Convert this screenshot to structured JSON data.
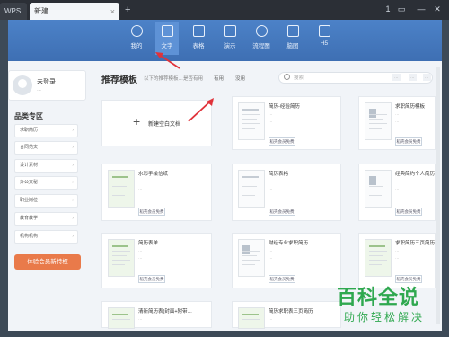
{
  "titlebar": {
    "app_label": "WPS",
    "tab_label": "新建",
    "tab_close": "×",
    "add_tab": "+",
    "controls": [
      "1",
      "▭",
      "—",
      "✕"
    ]
  },
  "categories": [
    {
      "label": "我的",
      "icon": "star-icon",
      "active": false
    },
    {
      "label": "文字",
      "icon": "doc-icon",
      "active": true
    },
    {
      "label": "表格",
      "icon": "table-icon",
      "active": false
    },
    {
      "label": "演示",
      "icon": "slide-icon",
      "active": false
    },
    {
      "label": "流程图",
      "icon": "flow-icon",
      "active": false
    },
    {
      "label": "脑图",
      "icon": "mindmap-icon",
      "active": false
    },
    {
      "label": "H5",
      "icon": "h5-icon",
      "active": false
    }
  ],
  "user": {
    "name": "未登录",
    "badge": "…"
  },
  "zone": {
    "title": "品类专区",
    "items": [
      "求职简历",
      "合同范文",
      "设计素材",
      "办公文秘",
      "职业岗位",
      "教育教学",
      "机构机构"
    ],
    "vip_button": "体验会员新特权"
  },
  "main": {
    "title": "推荐模板",
    "hint": "以下的推荐模板…是否有用",
    "feedback_yes": "有用",
    "feedback_no": "没用",
    "search_placeholder": "搜索",
    "chips": [
      "…",
      "…",
      "…"
    ],
    "blank_label": "新建空白文档"
  },
  "templates": [
    {
      "name": "简历-经验简历",
      "meta1": "…",
      "meta2": "…",
      "button": "稻壳会员免费"
    },
    {
      "name": "求职简历模板",
      "meta1": "…",
      "meta2": "…",
      "button": "稻壳会员免费"
    },
    {
      "name": "水彩手绘信纸",
      "meta1": "…",
      "meta2": "…",
      "button": "稻壳会员免费"
    },
    {
      "name": "简历表格",
      "meta1": "…",
      "meta2": "…",
      "button": "稻壳会员免费"
    },
    {
      "name": "经典简约个人简历",
      "meta1": "…",
      "meta2": "…",
      "button": "稻壳会员免费"
    },
    {
      "name": "简历表单",
      "meta1": "…",
      "meta2": "…",
      "button": "稻壳会员免费"
    },
    {
      "name": "财经专业求职简历",
      "meta1": "…",
      "meta2": "…",
      "button": "稻壳会员免费"
    },
    {
      "name": "求职简历三页简历",
      "meta1": "…",
      "meta2": "…",
      "button": "稻壳会员免费"
    },
    {
      "name": "清新简历表(封面+附带…",
      "meta1": "…",
      "meta2": "…",
      "button": "稻壳会员免费"
    },
    {
      "name": "简历求职表三页简历",
      "meta1": "…",
      "meta2": "…",
      "button": "稻壳会员免费"
    }
  ],
  "watermark": {
    "line1": "百科全说",
    "line2": "助你轻松解决"
  },
  "colors": {
    "accent": "#4c82c8",
    "vip": "#e97a4a",
    "arrow": "#e0323a",
    "watermark": "#2fa84f"
  }
}
